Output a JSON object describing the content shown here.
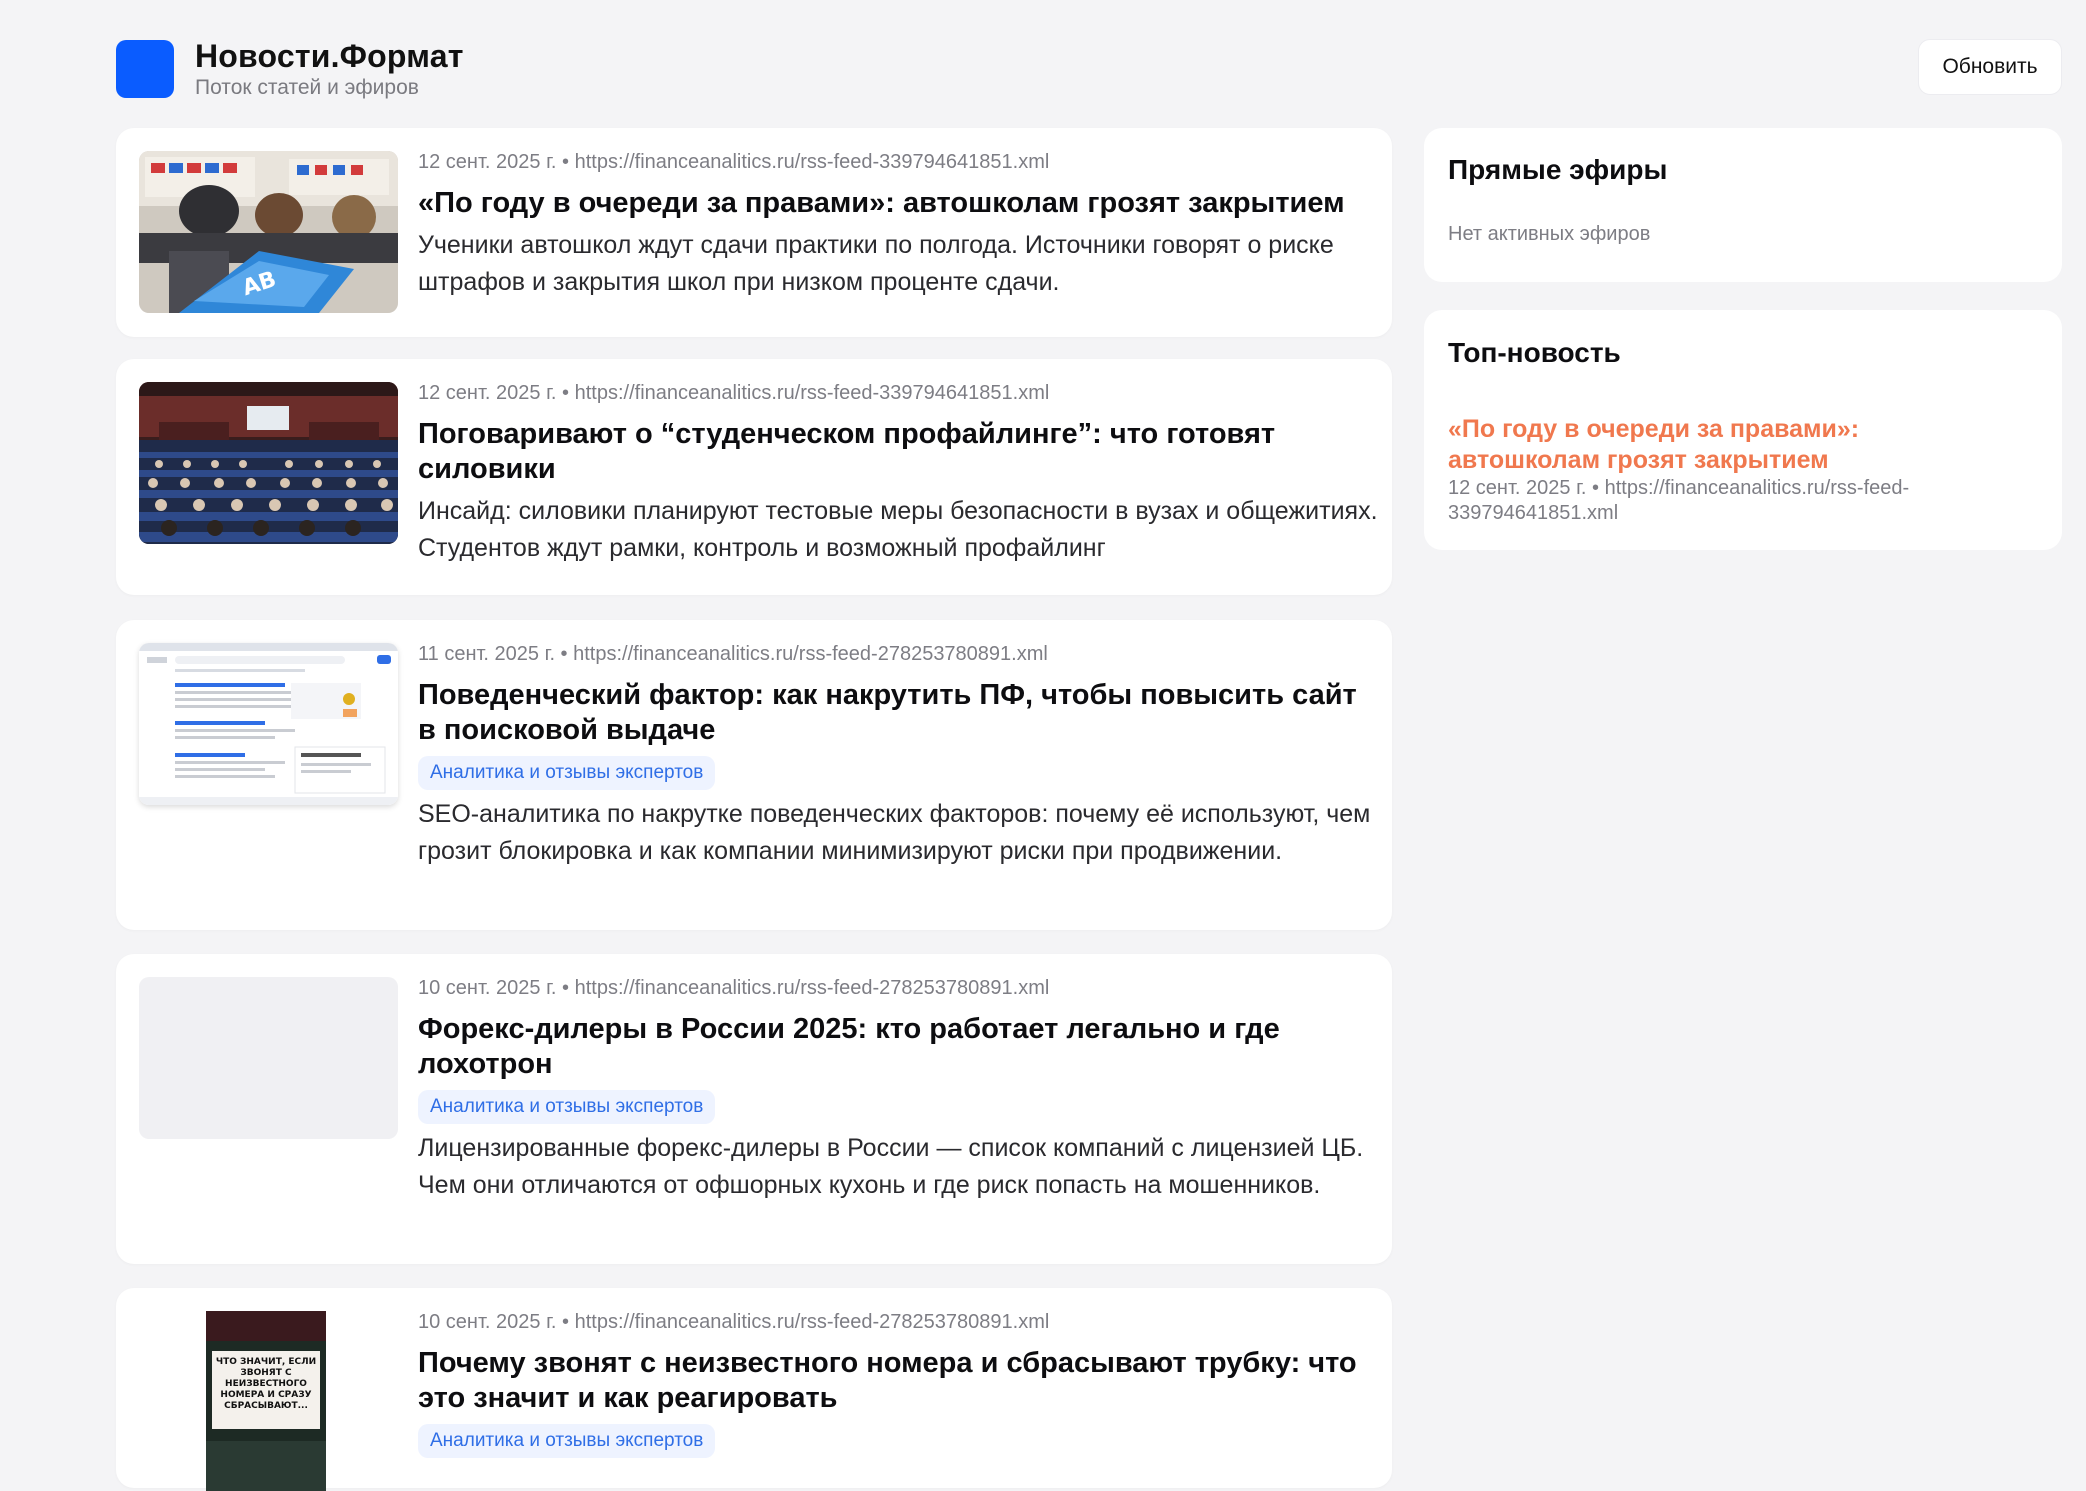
{
  "header": {
    "app_title": "Новости.Формат",
    "app_subtitle": "Поток статей и эфиров",
    "refresh_label": "Обновить"
  },
  "feed": [
    {
      "meta": "12 сент. 2025 г. • https://financeanalitics.ru/rss-feed-339794641851.xml",
      "title": "«По году в очереди за правами»: автошколам грозят закрытием",
      "tag": "",
      "description": "Ученики автошкол ждут сдачи практики по полгода. Источники говорят о риске штрафов и закрытия школ при низком проценте сдачи.",
      "thumb": "classroom-exam",
      "thumb_text": "AB"
    },
    {
      "meta": "12 сент. 2025 г. • https://financeanalitics.ru/rss-feed-339794641851.xml",
      "title": "Поговаривают о “студенческом профайлинге”: что готовят силовики",
      "tag": "",
      "description": "Инсайд: силовики планируют тестовые меры безопасности в вузах и общежитиях. Студентов ждут рамки, контроль и возможный профайлинг",
      "thumb": "auditorium"
    },
    {
      "meta": "11 сент. 2025 г. • https://financeanalitics.ru/rss-feed-278253780891.xml",
      "title": "Поведенческий фактор: как накрутить ПФ, чтобы повысить сайт в поисковой выдаче",
      "tag": "Аналитика и отзывы экспертов",
      "description": "SEO-аналитика по накрутке поведенческих факторов: почему её используют, чем грозит блокировка и как компании минимизируют риски при продвижении.",
      "thumb": "search-results-screenshot"
    },
    {
      "meta": "10 сент. 2025 г. • https://financeanalitics.ru/rss-feed-278253780891.xml",
      "title": "Форекс-дилеры в России 2025: кто работает легально и где лохотрон",
      "tag": "Аналитика и отзывы экспертов",
      "description": "Лицензированные форекс-дилеры в России — список компаний с лицензией ЦБ. Чем они отличаются от офшорных кухонь и где риск попасть на мошенников.",
      "thumb": "empty"
    },
    {
      "meta": "10 сент. 2025 г. • https://financeanalitics.ru/rss-feed-278253780891.xml",
      "title": "Почему звонят с неизвестного номера и сбрасывают трубку: что это значит и как реагировать",
      "tag": "Аналитика и отзывы экспертов",
      "description": "",
      "thumb": "poster",
      "thumb_text": "ЧТО ЗНАЧИТ, ЕСЛИ ЗВОНЯТ С НЕИЗВЕСТНОГО НОМЕРА И СРАЗУ СБРАСЫВАЮТ..."
    }
  ],
  "sidebar": {
    "live": {
      "heading": "Прямые эфиры",
      "empty_text": "Нет активных эфиров"
    },
    "top": {
      "heading": "Топ-новость",
      "link_text": "«По году в очереди за правами»: автошколам грозят закрытием",
      "meta": "12 сент. 2025 г. • https://financeanalitics.ru/rss-feed-339794641851.xml"
    }
  },
  "colors": {
    "background": "#f4f4f6",
    "brand": "#0a5cff",
    "tag_text": "#2f6ee6",
    "tag_bg": "#eef3ff",
    "top_link": "#f0784e"
  }
}
